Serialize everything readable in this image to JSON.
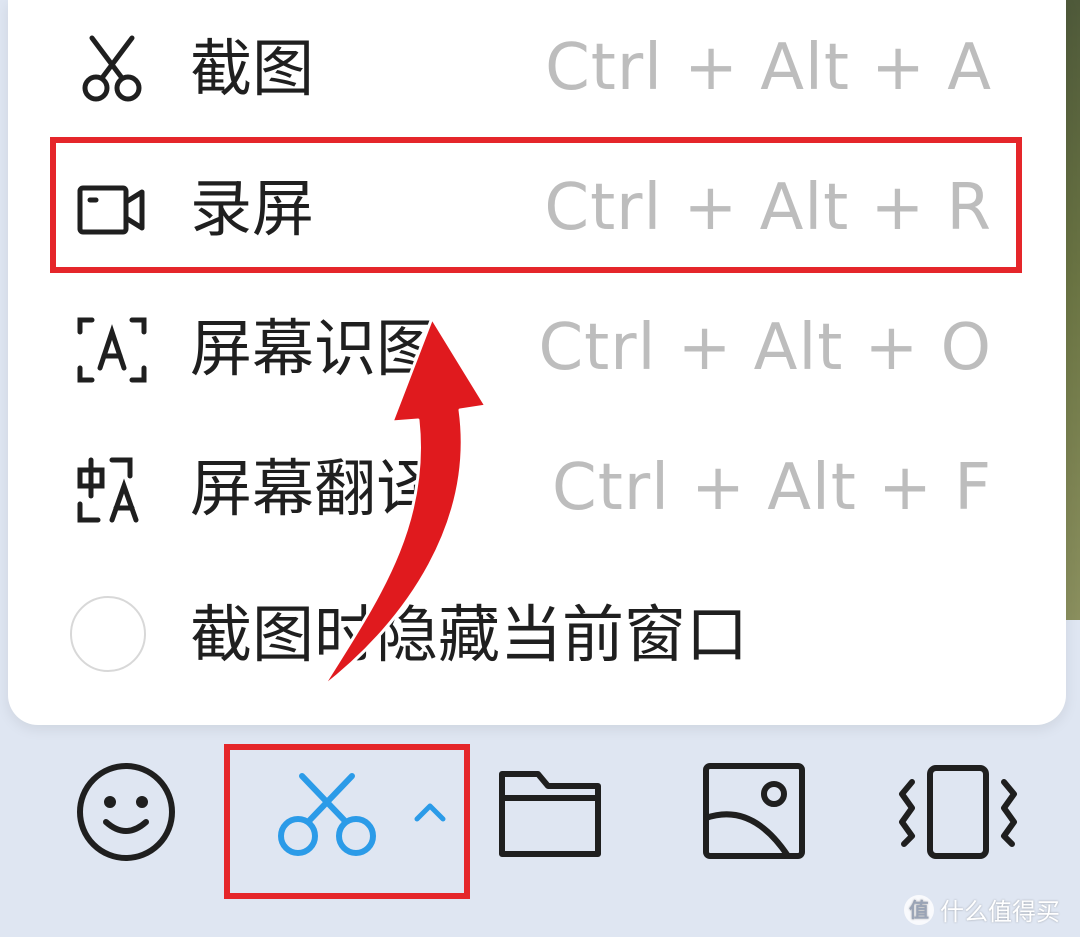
{
  "menu": {
    "items": [
      {
        "label": "截图",
        "shortcut": "Ctrl + Alt + A",
        "icon": "scissors-icon"
      },
      {
        "label": "录屏",
        "shortcut": "Ctrl + Alt + R",
        "icon": "video-camera-icon"
      },
      {
        "label": "屏幕识图",
        "shortcut": "Ctrl + Alt + O",
        "icon": "text-recognition-icon"
      },
      {
        "label": "屏幕翻译",
        "shortcut": "Ctrl + Alt + F",
        "icon": "translate-icon"
      }
    ],
    "hide_window_option": {
      "label": "截图时隐藏当前窗口",
      "checked": false
    }
  },
  "toolbar": {
    "buttons": [
      "emoji-icon",
      "scissors-icon",
      "chevron-up-icon",
      "folder-icon",
      "image-icon",
      "vibrate-phone-icon"
    ]
  },
  "colors": {
    "highlight": "#e5262a",
    "accent": "#2b9be8",
    "shortcut_text": "#bdbdbd"
  },
  "watermark": {
    "text": "什么值得买",
    "logo": "值"
  }
}
